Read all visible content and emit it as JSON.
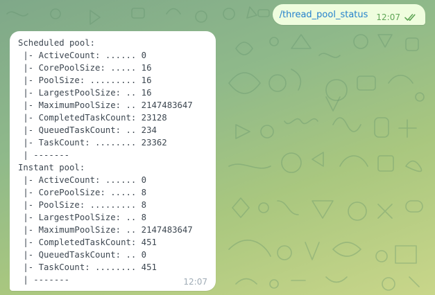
{
  "outgoing_message": {
    "text": "/thread_pool_status",
    "time": "12:07",
    "status_icon": "double-check-icon"
  },
  "incoming_message": {
    "time": "12:07",
    "lines": [
      "Scheduled pool:",
      " |- ActiveCount: ...... 0",
      " |- CorePoolSize: ..... 16",
      " |- PoolSize: ......... 16",
      " |- LargestPoolSize: .. 16",
      " |- MaximumPoolSize: .. 2147483647",
      " |- CompletedTaskCount: 23128",
      " |- QueuedTaskCount: .. 234",
      " |- TaskCount: ........ 23362",
      " | -------",
      "Instant pool:",
      " |- ActiveCount: ...... 0",
      " |- CorePoolSize: ..... 8",
      " |- PoolSize: ......... 8",
      " |- LargestPoolSize: .. 8",
      " |- MaximumPoolSize: .. 2147483647",
      " |- CompletedTaskCount: 451",
      " |- QueuedTaskCount: .. 0",
      " |- TaskCount: ........ 451",
      " | -------"
    ]
  },
  "colors": {
    "outgoing_bubble": "#effdde",
    "outgoing_link": "#2481cc",
    "outgoing_meta": "#5fa556",
    "incoming_bubble": "#ffffff",
    "incoming_text": "#3c4650",
    "incoming_meta": "#a0acb6"
  }
}
